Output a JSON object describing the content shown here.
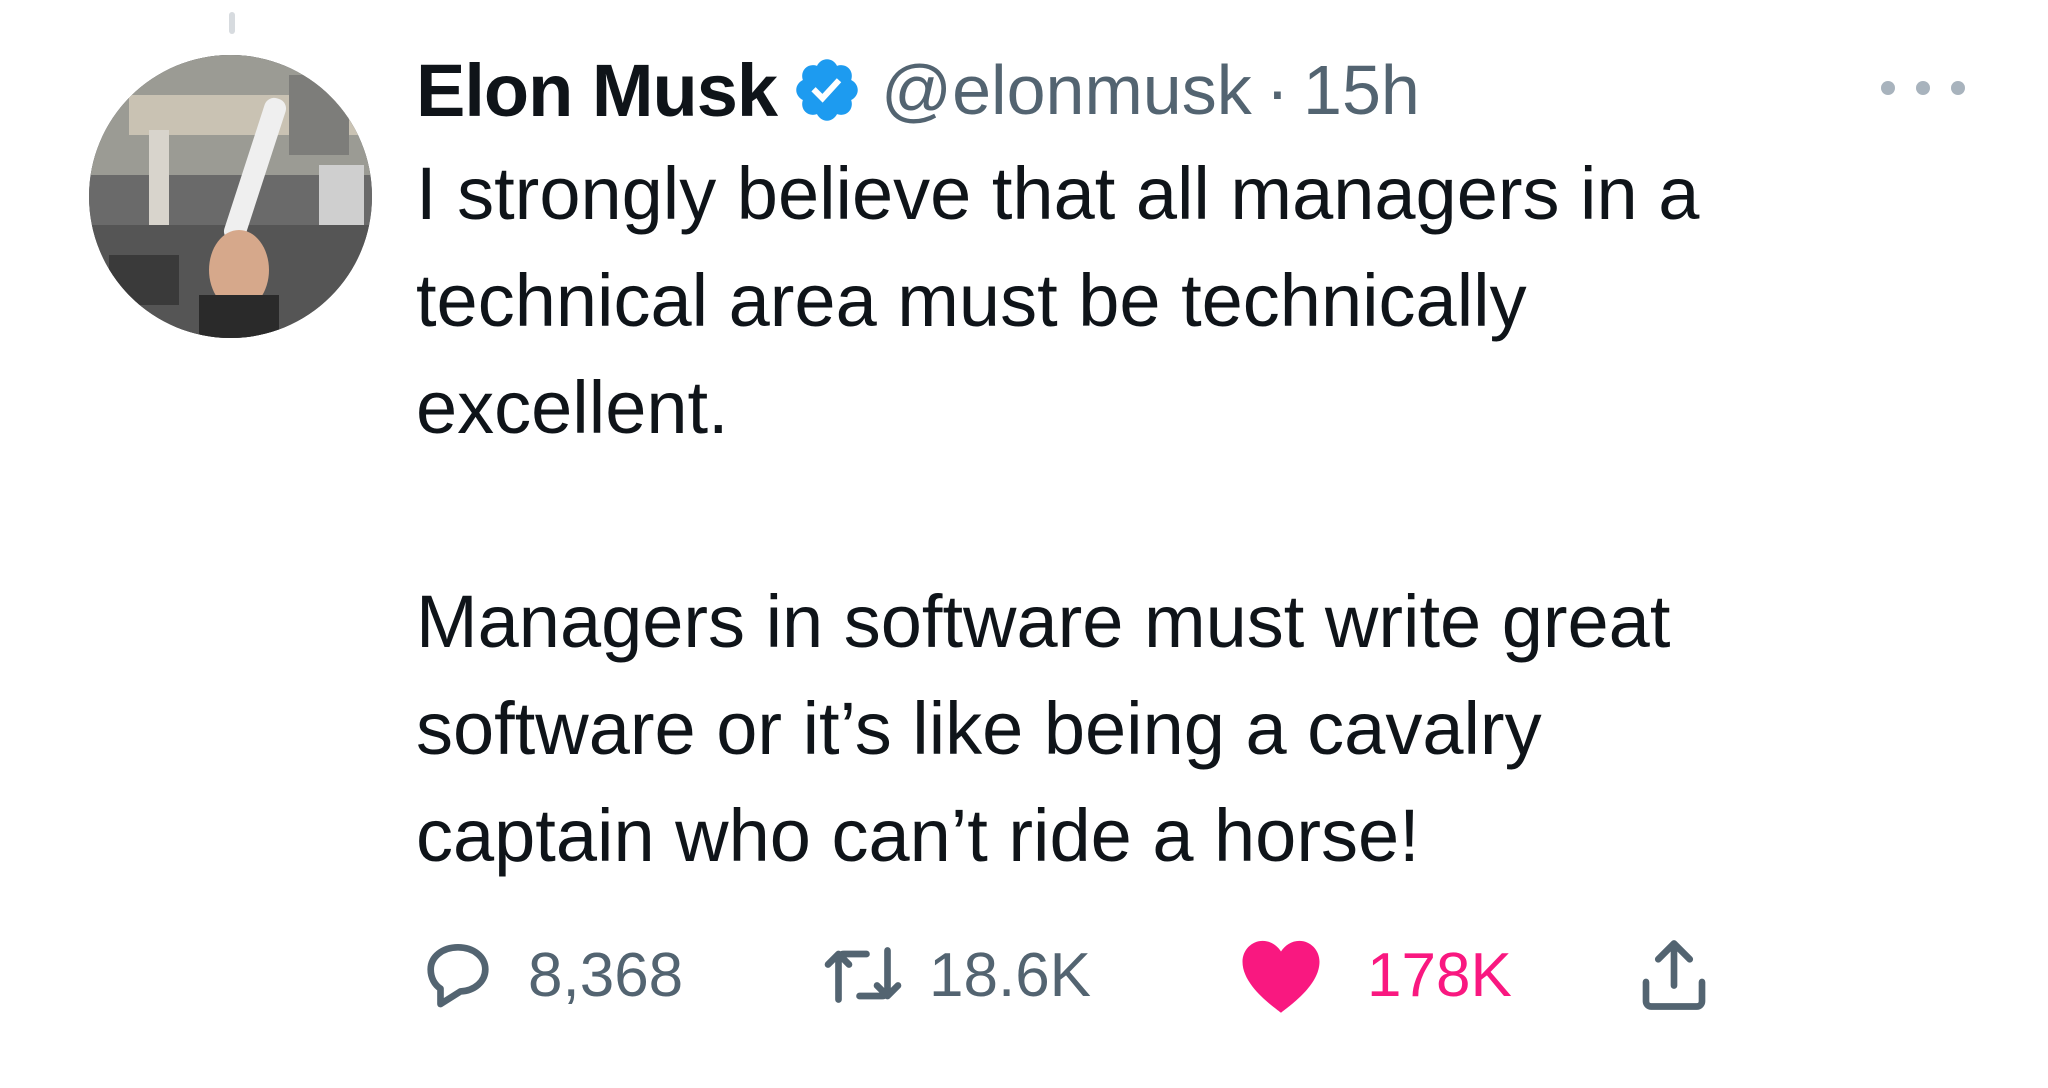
{
  "tweet": {
    "author": {
      "display_name": "Elon Musk",
      "handle": "@elonmusk",
      "verified": true
    },
    "separator": "·",
    "time": "15h",
    "text_paragraphs": [
      [
        "I strongly believe that all managers in a",
        "technical area must be technically",
        "excellent."
      ],
      [
        "Managers in software must write great",
        "software or it’s like being a cavalry",
        "captain who can’t ride a horse!"
      ]
    ],
    "stats": {
      "replies": "8,368",
      "retweets": "18.6K",
      "likes": "178K"
    }
  },
  "colors": {
    "text_primary": "#0f1419",
    "text_secondary": "#536471",
    "verified_blue": "#1d9bf0",
    "like_pink": "#f91880"
  },
  "icons": {
    "verified": "verified-badge-icon",
    "more": "more-horizontal-icon",
    "reply": "reply-icon",
    "retweet": "retweet-icon",
    "like": "heart-icon",
    "share": "share-icon"
  }
}
